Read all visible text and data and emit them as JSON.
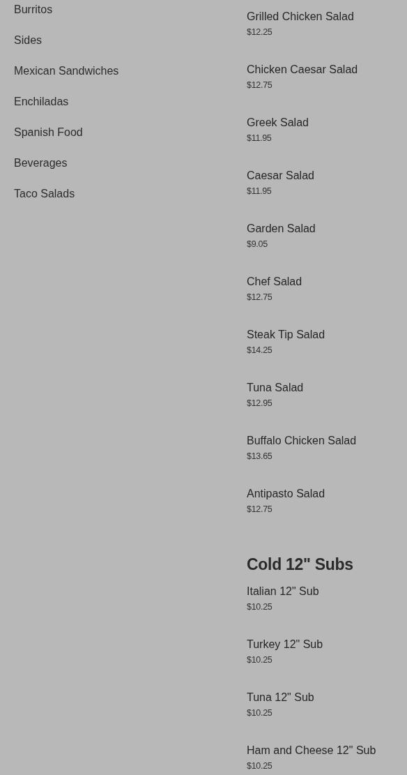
{
  "categories": [
    {
      "label": "Burritos"
    },
    {
      "label": "Sides"
    },
    {
      "label": "Mexican Sandwiches"
    },
    {
      "label": "Enchiladas"
    },
    {
      "label": "Spanish Food"
    },
    {
      "label": "Beverages"
    },
    {
      "label": "Taco Salads"
    }
  ],
  "sections": [
    {
      "items": [
        {
          "name": "Grilled Chicken Salad",
          "price": "$12.25"
        },
        {
          "name": "Chicken Caesar Salad",
          "price": "$12.75"
        },
        {
          "name": "Greek Salad",
          "price": "$11.95"
        },
        {
          "name": "Caesar Salad",
          "price": "$11.95"
        },
        {
          "name": "Garden Salad",
          "price": "$9.05"
        },
        {
          "name": "Chef Salad",
          "price": "$12.75"
        },
        {
          "name": "Steak Tip Salad",
          "price": "$14.25"
        },
        {
          "name": "Tuna Salad",
          "price": "$12.95"
        },
        {
          "name": "Buffalo Chicken Salad",
          "price": "$13.65"
        },
        {
          "name": "Antipasto Salad",
          "price": "$12.75"
        }
      ]
    },
    {
      "title": "Cold 12\" Subs",
      "items": [
        {
          "name": "Italian 12\" Sub",
          "price": "$10.25"
        },
        {
          "name": "Turkey 12\" Sub",
          "price": "$10.25"
        },
        {
          "name": "Tuna 12\" Sub",
          "price": "$10.25"
        },
        {
          "name": "Ham and Cheese 12\" Sub",
          "price": "$10.25"
        }
      ]
    }
  ]
}
